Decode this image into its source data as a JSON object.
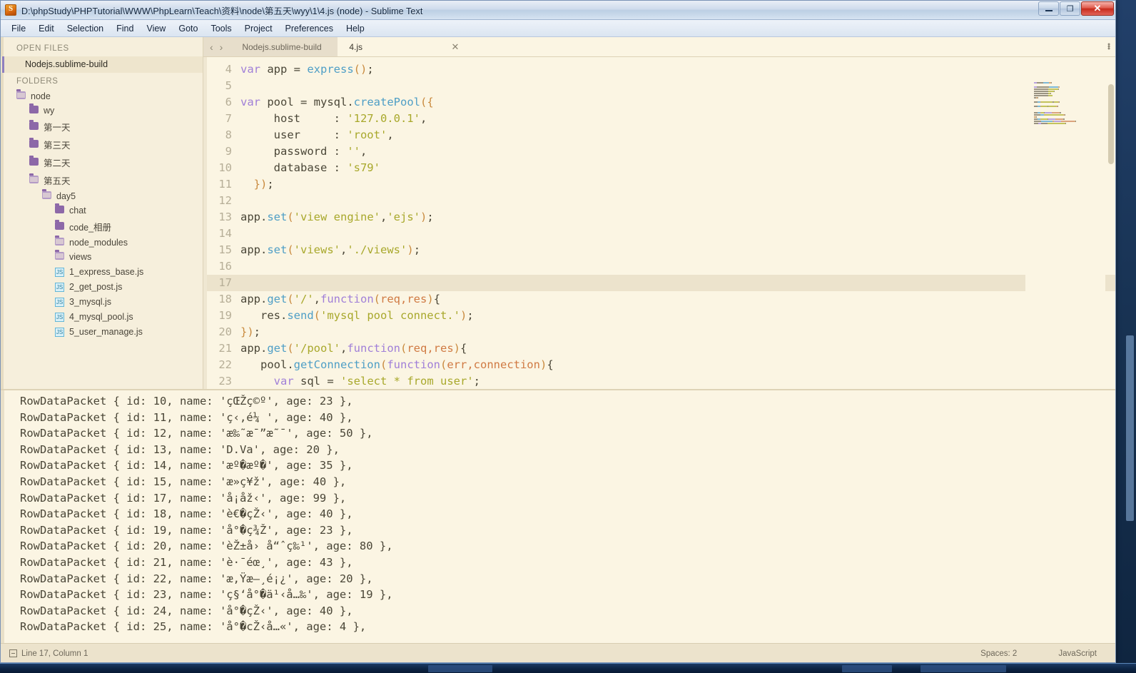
{
  "window": {
    "title": "D:\\phpStudy\\PHPTutorial\\WWW\\PhpLearn\\Teach\\资料\\node\\第五天\\wyy\\1\\4.js (node) - Sublime Text",
    "app_icon": "sublime-text-icon",
    "controls": {
      "minimize": "–",
      "maximize": "❐",
      "close": "✕"
    }
  },
  "menubar": {
    "items": [
      "File",
      "Edit",
      "Selection",
      "Find",
      "View",
      "Goto",
      "Tools",
      "Project",
      "Preferences",
      "Help"
    ]
  },
  "sidebar": {
    "open_files_header": "OPEN FILES",
    "open_files": [
      {
        "label": "Nodejs.sublime-build"
      }
    ],
    "folders_header": "FOLDERS",
    "tree": [
      {
        "label": "node",
        "type": "folder-open",
        "depth": 0
      },
      {
        "label": "wy",
        "type": "folder",
        "depth": 1
      },
      {
        "label": "第一天",
        "type": "folder",
        "depth": 1
      },
      {
        "label": "第三天",
        "type": "folder",
        "depth": 1
      },
      {
        "label": "第二天",
        "type": "folder",
        "depth": 1
      },
      {
        "label": "第五天",
        "type": "folder-open",
        "depth": 1
      },
      {
        "label": "day5",
        "type": "folder-open",
        "depth": 2
      },
      {
        "label": "chat",
        "type": "folder",
        "depth": 3
      },
      {
        "label": "code_相册",
        "type": "folder",
        "depth": 3
      },
      {
        "label": "node_modules",
        "type": "folder-open",
        "depth": 3
      },
      {
        "label": "views",
        "type": "folder-open",
        "depth": 3
      },
      {
        "label": "1_express_base.js",
        "type": "js",
        "depth": 3
      },
      {
        "label": "2_get_post.js",
        "type": "js",
        "depth": 3
      },
      {
        "label": "3_mysql.js",
        "type": "js",
        "depth": 3
      },
      {
        "label": "4_mysql_pool.js",
        "type": "js",
        "depth": 3
      },
      {
        "label": "5_user_manage.js",
        "type": "js",
        "depth": 3
      }
    ]
  },
  "editor": {
    "nav": {
      "prev": "‹",
      "next": "›"
    },
    "tabs": [
      {
        "label": "Nodejs.sublime-build",
        "active": false,
        "closable": false
      },
      {
        "label": "4.js",
        "active": true,
        "closable": true,
        "close_label": "✕"
      }
    ],
    "overflow_menu": "kebab-menu-icon",
    "first_line_number": 4,
    "current_line": 17,
    "lines": [
      {
        "n": 4,
        "tokens": [
          [
            "kw",
            "var"
          ],
          [
            "plain",
            " app "
          ],
          [
            "punc",
            "= "
          ],
          [
            "fn",
            "express"
          ],
          [
            "par",
            "()"
          ],
          [
            "punc",
            ";"
          ]
        ]
      },
      {
        "n": 5,
        "tokens": []
      },
      {
        "n": 6,
        "tokens": [
          [
            "kw",
            "var"
          ],
          [
            "plain",
            " pool "
          ],
          [
            "punc",
            "= "
          ],
          [
            "plain",
            "mysql."
          ],
          [
            "fn",
            "createPool"
          ],
          [
            "par",
            "({"
          ]
        ]
      },
      {
        "n": 7,
        "tokens": [
          [
            "plain",
            "     host     : "
          ],
          [
            "str",
            "'127.0.0.1'"
          ],
          [
            "punc",
            ","
          ]
        ]
      },
      {
        "n": 8,
        "tokens": [
          [
            "plain",
            "     user     : "
          ],
          [
            "str",
            "'root'"
          ],
          [
            "punc",
            ","
          ]
        ]
      },
      {
        "n": 9,
        "tokens": [
          [
            "plain",
            "     password : "
          ],
          [
            "str",
            "''"
          ],
          [
            "punc",
            ","
          ]
        ]
      },
      {
        "n": 10,
        "tokens": [
          [
            "plain",
            "     database : "
          ],
          [
            "str",
            "'s79'"
          ]
        ]
      },
      {
        "n": 11,
        "tokens": [
          [
            "plain",
            "  "
          ],
          [
            "par",
            "})"
          ],
          [
            "punc",
            ";"
          ]
        ]
      },
      {
        "n": 12,
        "tokens": []
      },
      {
        "n": 13,
        "tokens": [
          [
            "plain",
            "app."
          ],
          [
            "fn",
            "set"
          ],
          [
            "par",
            "("
          ],
          [
            "str",
            "'view engine'"
          ],
          [
            "punc",
            ","
          ],
          [
            "str",
            "'ejs'"
          ],
          [
            "par",
            ")"
          ],
          [
            "punc",
            ";"
          ]
        ]
      },
      {
        "n": 14,
        "tokens": []
      },
      {
        "n": 15,
        "tokens": [
          [
            "plain",
            "app."
          ],
          [
            "fn",
            "set"
          ],
          [
            "par",
            "("
          ],
          [
            "str",
            "'views'"
          ],
          [
            "punc",
            ","
          ],
          [
            "str",
            "'./views'"
          ],
          [
            "par",
            ")"
          ],
          [
            "punc",
            ";"
          ]
        ]
      },
      {
        "n": 16,
        "tokens": []
      },
      {
        "n": 17,
        "tokens": []
      },
      {
        "n": 18,
        "tokens": [
          [
            "plain",
            "app."
          ],
          [
            "fn",
            "get"
          ],
          [
            "par",
            "("
          ],
          [
            "str",
            "'/'"
          ],
          [
            "punc",
            ","
          ],
          [
            "kw",
            "function"
          ],
          [
            "par",
            "("
          ],
          [
            "argm",
            "req,res"
          ],
          [
            "par",
            ")"
          ],
          [
            "punc",
            "{"
          ]
        ]
      },
      {
        "n": 19,
        "tokens": [
          [
            "plain",
            "   res."
          ],
          [
            "fn",
            "send"
          ],
          [
            "par",
            "("
          ],
          [
            "str",
            "'mysql pool connect.'"
          ],
          [
            "par",
            ")"
          ],
          [
            "punc",
            ";"
          ]
        ]
      },
      {
        "n": 20,
        "tokens": [
          [
            "par",
            "})"
          ],
          [
            "punc",
            ";"
          ]
        ]
      },
      {
        "n": 21,
        "tokens": [
          [
            "plain",
            "app."
          ],
          [
            "fn",
            "get"
          ],
          [
            "par",
            "("
          ],
          [
            "str",
            "'/pool'"
          ],
          [
            "punc",
            ","
          ],
          [
            "kw",
            "function"
          ],
          [
            "par",
            "("
          ],
          [
            "argm",
            "req,res"
          ],
          [
            "par",
            ")"
          ],
          [
            "punc",
            "{"
          ]
        ]
      },
      {
        "n": 22,
        "tokens": [
          [
            "plain",
            "   pool."
          ],
          [
            "fn",
            "getConnection"
          ],
          [
            "par",
            "("
          ],
          [
            "kw",
            "function"
          ],
          [
            "par",
            "("
          ],
          [
            "argm",
            "err,connection"
          ],
          [
            "par",
            ")"
          ],
          [
            "punc",
            "{"
          ]
        ]
      },
      {
        "n": 23,
        "tokens": [
          [
            "plain",
            "     "
          ],
          [
            "kw",
            "var"
          ],
          [
            "plain",
            " sql "
          ],
          [
            "punc",
            "= "
          ],
          [
            "str",
            "'select * from user'"
          ],
          [
            "punc",
            ";"
          ]
        ]
      }
    ]
  },
  "console": {
    "rows": [
      "RowDataPacket { id: 10, name: 'çŒŽç©º', age: 23 },",
      "RowDataPacket { id: 11, name: 'ç‹‚é¼ ', age: 40 },",
      "RowDataPacket { id: 12, name: 'æ‰˜æ¯”æ˜¯', age: 50 },",
      "RowDataPacket { id: 13, name: 'D.Va', age: 20 },",
      "RowDataPacket { id: 14, name: 'æº�æº�', age: 35 },",
      "RowDataPacket { id: 15, name: 'æ»ç¥ž', age: 40 },",
      "RowDataPacket { id: 17, name: 'å¡åž‹', age: 99 },",
      "RowDataPacket { id: 18, name: 'è€�çŽ‹', age: 40 },",
      "RowDataPacket { id: 19, name: 'å°�ç¾Ž', age: 23 },",
      "RowDataPacket { id: 20, name: 'èŽ±å› å“ˆç‰¹', age: 80 },",
      "RowDataPacket { id: 21, name: 'è·¯éœ¸', age: 43 },",
      "RowDataPacket { id: 22, name: 'æ‚Ÿæ—¸é¡¿', age: 20 },",
      "RowDataPacket { id: 23, name: 'ç§‘å°�ä¹‹å…‰', age: 19 },",
      "RowDataPacket { id: 24, name: 'å°�çŽ‹', age: 40 },",
      "RowDataPacket { id: 25, name: 'å°�cŽ‹å…«', age: 4 },"
    ]
  },
  "statusbar": {
    "icon": "panel-icon",
    "cursor": "Line 17, Column 1",
    "indent": "Spaces: 2",
    "syntax": "JavaScript"
  }
}
